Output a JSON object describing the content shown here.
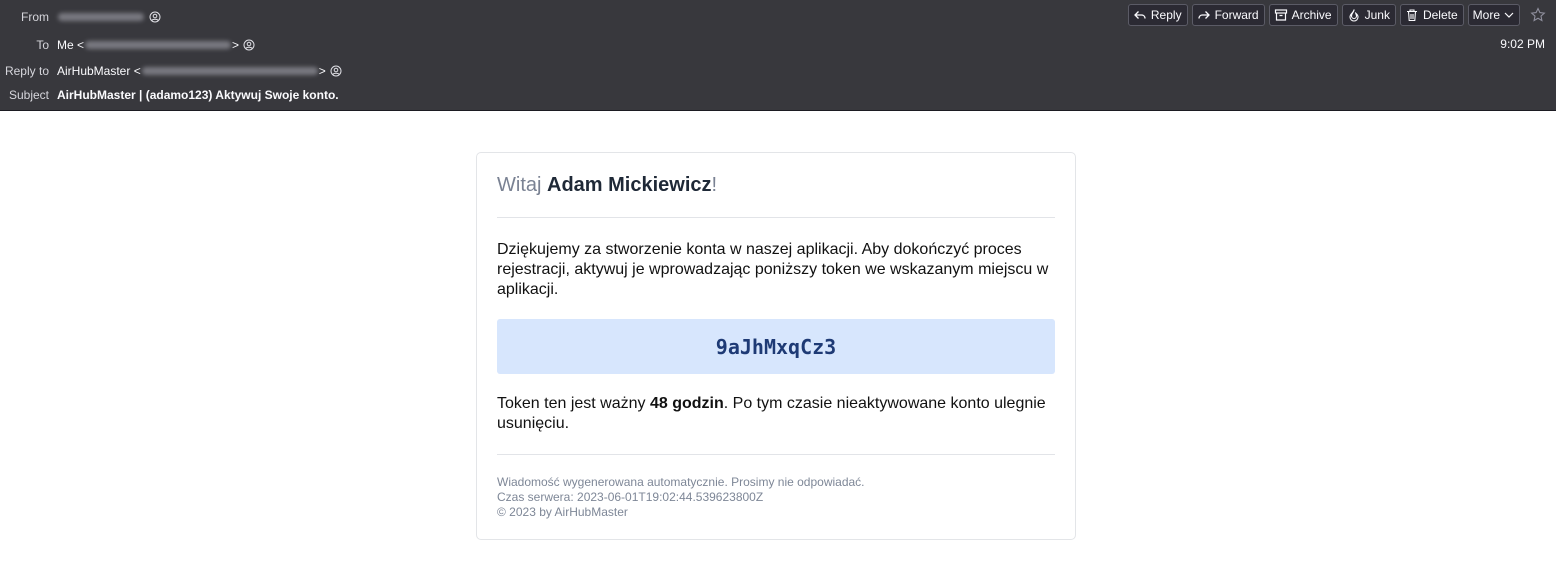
{
  "header": {
    "from_label": "From",
    "to_label": "To",
    "to_name": "Me <",
    "to_suffix": ">",
    "replyto_label": "Reply to",
    "replyto_name": "AirHubMaster <",
    "replyto_suffix": ">",
    "subject_label": "Subject",
    "subject": "AirHubMaster | (adamo123) Aktywuj Swoje konto.",
    "time": "9:02 PM"
  },
  "toolbar": {
    "reply": "Reply",
    "forward": "Forward",
    "archive": "Archive",
    "junk": "Junk",
    "delete": "Delete",
    "more": "More"
  },
  "email": {
    "greeting_prefix": "Witaj ",
    "greeting_name": "Adam Mickiewicz",
    "greeting_suffix": "!",
    "paragraph1": "Dziękujemy za stworzenie konta w naszej aplikacji. Aby dokończyć proces rejestracji, aktywuj je wprowadzając poniższy token we wskazanym miejscu w aplikacji.",
    "token": "9aJhMxqCz3",
    "para2_before": "Token ten jest ważny ",
    "para2_bold": "48 godzin",
    "para2_after": ". Po tym czasie nieaktywowane konto ulegnie usunięciu.",
    "footer_line1": "Wiadomość wygenerowana automatycznie. Prosimy nie odpowiadać.",
    "footer_line2": "Czas serwera: 2023-06-01T19:02:44.539623800Z",
    "footer_line3": "© 2023 by AirHubMaster"
  },
  "colors": {
    "header_bg": "#38383d",
    "token_bg": "#d7e6fd",
    "token_text": "#1e3a75"
  }
}
